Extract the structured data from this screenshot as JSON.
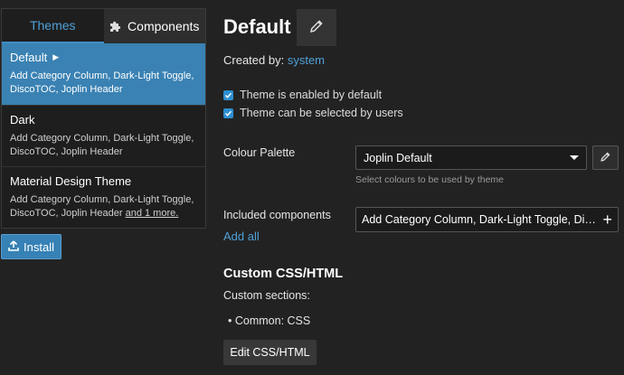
{
  "sidebar": {
    "tabs": [
      {
        "label": "Themes",
        "icon": "none"
      },
      {
        "label": "Components",
        "icon": "puzzle-icon"
      }
    ],
    "themes": [
      {
        "name": "Default",
        "selected": true,
        "description": "Add Category Column, Dark-Light Toggle, DiscoTOC, Joplin Header",
        "more": ""
      },
      {
        "name": "Dark",
        "selected": false,
        "description": "Add Category Column, Dark-Light Toggle, DiscoTOC, Joplin Header",
        "more": ""
      },
      {
        "name": "Material Design Theme",
        "selected": false,
        "description": "Add Category Column, Dark-Light Toggle, DiscoTOC, Joplin Header",
        "more": "and 1 more."
      }
    ],
    "install_label": "Install"
  },
  "main": {
    "title": "Default",
    "created_by_label": "Created by:",
    "created_by_author": "system",
    "checkboxes": [
      {
        "label": "Theme is enabled by default",
        "checked": true
      },
      {
        "label": "Theme can be selected by users",
        "checked": true
      }
    ],
    "palette": {
      "label": "Colour Palette",
      "selected": "Joplin Default",
      "hint": "Select colours to be used by theme"
    },
    "components": {
      "label": "Included components",
      "value": "Add Category Column, Dark-Light Toggle, DiscoTOC, Joplin Header",
      "add_all": "Add all"
    },
    "custom": {
      "title": "Custom CSS/HTML",
      "sections_label": "Custom sections:",
      "sections": [
        "Common: CSS"
      ],
      "edit_button": "Edit CSS/HTML"
    }
  },
  "colors": {
    "accent": "#3a82b3",
    "link": "#4fa0d8",
    "background": "#222222"
  }
}
